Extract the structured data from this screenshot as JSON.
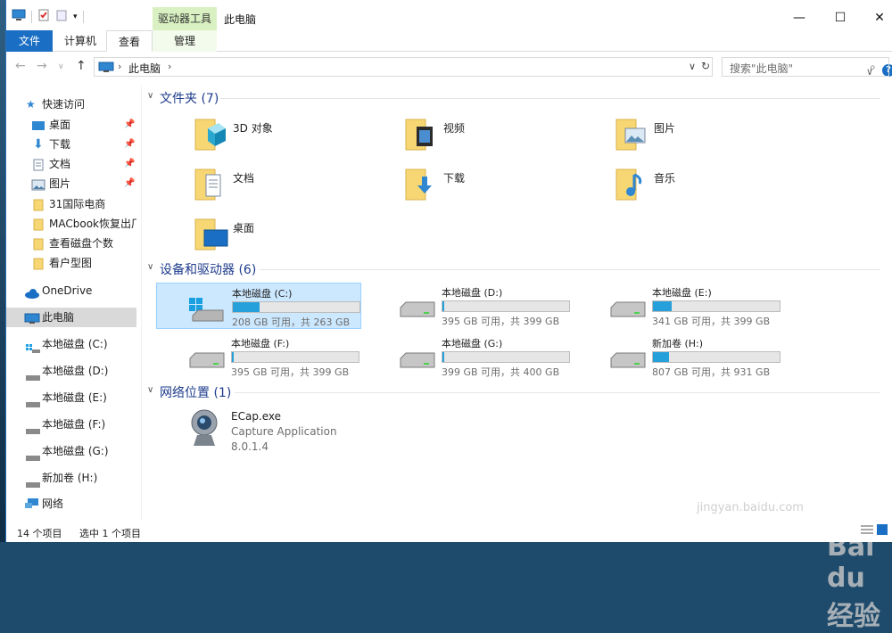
{
  "window": {
    "title": "此电脑",
    "context_tab_group": "驱动器工具"
  },
  "ribbon": {
    "tabs": [
      "文件",
      "计算机",
      "查看",
      "管理"
    ]
  },
  "address": {
    "crumb": "此电脑",
    "search_placeholder": "搜索\"此电脑\""
  },
  "nav": {
    "quick_access": "快速访问",
    "pinned": [
      "桌面",
      "下载",
      "文档",
      "图片"
    ],
    "recent": [
      "31国际电商",
      "MACbook恢复出厂",
      "查看磁盘个数",
      "看户型图"
    ],
    "onedrive": "OneDrive",
    "this_pc": "此电脑",
    "drives": [
      "本地磁盘 (C:)",
      "本地磁盘 (D:)",
      "本地磁盘 (E:)",
      "本地磁盘 (F:)",
      "本地磁盘 (G:)",
      "新加卷 (H:)"
    ],
    "network": "网络"
  },
  "groups": {
    "folders": "文件夹 (7)",
    "devices": "设备和驱动器 (6)",
    "network": "网络位置 (1)"
  },
  "folders": [
    "3D 对象",
    "视频",
    "图片",
    "文档",
    "下载",
    "音乐",
    "桌面"
  ],
  "drives": [
    {
      "name": "本地磁盘 (C:)",
      "free": "208 GB 可用，共 263 GB",
      "used_fraction": 0.21
    },
    {
      "name": "本地磁盘 (D:)",
      "free": "395 GB 可用，共 399 GB",
      "used_fraction": 0.01
    },
    {
      "name": "本地磁盘 (E:)",
      "free": "341 GB 可用，共 399 GB",
      "used_fraction": 0.15
    },
    {
      "name": "本地磁盘 (F:)",
      "free": "395 GB 可用，共 399 GB",
      "used_fraction": 0.01
    },
    {
      "name": "本地磁盘 (G:)",
      "free": "399 GB 可用，共 400 GB",
      "used_fraction": 0.003
    },
    {
      "name": "新加卷 (H:)",
      "free": "807 GB 可用，共 931 GB",
      "used_fraction": 0.13
    }
  ],
  "network_item": {
    "name": "ECap.exe",
    "description": "Capture Application",
    "version": "8.0.1.4"
  },
  "status": {
    "count": "14 个项目",
    "selected": "选中 1 个项目"
  },
  "watermark": {
    "brand": "Bai du 经验",
    "url": "jingyan.baidu.com"
  },
  "colors": {
    "accent": "#1a6fc4",
    "progress": "#26a0da",
    "selection": "#cce8ff",
    "group_title": "#1e3c8c"
  }
}
